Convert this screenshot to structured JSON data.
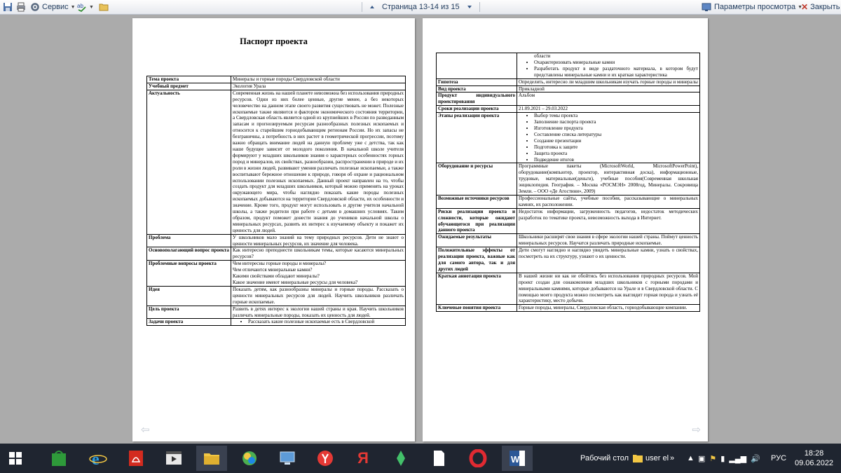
{
  "toolbar": {
    "service_label": "Сервис",
    "page_indicator": "Страница 13-14 из 15",
    "view_params_label": "Параметры просмотра",
    "close_label": "Закрыть"
  },
  "page1": {
    "title": "Паспорт проекта",
    "rows": [
      {
        "label": "Тема проекта",
        "value": "Минералы и горные породы Свердловской области"
      },
      {
        "label": "Учебный предмет",
        "value": "Экология Урала"
      },
      {
        "label": "Актуальность",
        "value": "Современная жизнь на нашей планете невозможна без использования природных ресурсов. Одни из них более ценные, другие менее, а без некоторых человечество на данном этапе своего развития существовать не может. Полезные ископаемые также являются и фактором экономического состояния территории, а Свердловская область является одной из крупнейших в России по разведанным запасам и прогнозируемым ресурсам разнообразных полезных ископаемых и относится к старейшим горнодобывающим регионам России. Но их запасы не безграничны, а потребность в них растет в геометрической прогрессии, поэтому важно обращать внимание людей на данную проблему уже с детства, так как наше будущее зависит от молодого поколения. В начальной школе учителя формируют у младших школьников знания о характерных особенностях горных пород и минералов, их свойствах, разнообразии, распространении в природе и их роли в жизни людей, развивают умения различать полезные ископаемые, а также воспитывают бережное отношение к природе, говоря об охране и рациональном использовании полезных ископаемых. Данный проект направлен на то, чтобы создать продукт для младших школьников, который можно применять на уроках окружающего мира, чтобы наглядно показать какие породы полезных ископаемых добываются на территории Свердловской области, их особенности и значение. Кроме того, продукт могут использовать и другие учителя начальной школы, а также родители при работе с детьми в домашних условиях. Таким образом, продукт поможет донести знания до учеников начальной школы о минеральных ресурсах, развить их интерес к изучаемому объекту и покажет их ценность для людей."
      },
      {
        "label": "Проблема",
        "value": "У школьников мало знаний на тему природных ресурсов. Дети не знают о ценности минеральных ресурсов, их значение для человека."
      },
      {
        "label": "Основополагающий вопрос проекта",
        "value": "Как интересно преподнести школьникам темы, которые касаются минеральных ресурсов?"
      },
      {
        "label": "Проблемные вопросы проекта",
        "value_lines": [
          "Чем интересны горные породы и минералы?",
          "Чем отличаются минеральные камни?",
          "Какими свойствами обладают минералы?",
          "Какое значение имеют минеральные ресурсы для человека?"
        ]
      },
      {
        "label": "Идея",
        "value": "Показать детям, как разнообразны минералы и горные породы. Рассказать о ценности минеральных ресурсов для людей. Научить школьников различать горные ископаемые."
      },
      {
        "label": "Цель проекта",
        "value": "Развить в детях интерес к экологии нашей страны и края. Научить школьников различать минеральные породы, показать их ценность для людей."
      },
      {
        "label": "Задачи проекта",
        "bullets": [
          "Рассказать какие полезные ископаемые есть в Свердловской"
        ]
      }
    ]
  },
  "page2": {
    "rows": [
      {
        "label": "",
        "bullets": [
          "области",
          "Охарактеризовать минеральные камни",
          "Разработать продукт в виде раздаточного материала, в котором будут представлены минеральные камни и их краткая характеристика"
        ],
        "first_plain": true
      },
      {
        "label": "Гипотеза",
        "value": "Определить, интересно ли младшим школьникам изучать горные породы и минералы"
      },
      {
        "label": "Вид проекта",
        "value": "Прикладной"
      },
      {
        "label": "Продукт индивидуального проектирования",
        "value": "Альбом"
      },
      {
        "label": "Сроки реализации проекта",
        "value": "21.09.2021 – 29.03.2022"
      },
      {
        "label": "Этапы реализации проекта",
        "bullets": [
          "Выбор темы проекта",
          "Заполнение паспорта проекта",
          "Изготовление продукта",
          "Составление списка литературы",
          "Создание презентации",
          "Подготовка к защите",
          "Защита проекта",
          "Подведение итогов"
        ]
      },
      {
        "label": "Оборудование и ресурсы",
        "value": "Программные пакеты (MicrosoftWorld, MicrosoftPowerPoint), оборудование(компьютер, проектор, интерактивная доска), информационные, трудовые, материальные(деньги), учебные пособия(Современная школьная энциклопедия. География. – Москва «РОСМЭН» 2008год, Минералы. Сокровища Земли. – ООО «Де Агостини», 2009)"
      },
      {
        "label": "Возможные источники ресурсов",
        "value": "Профессиональные сайты, учебные пособия, рассказывающие о минеральных камнях, их расположении."
      },
      {
        "label": "Риски реализации проекта и сложности, которые ожидают обучающегося при реализации данного проекта",
        "value": "Недостаток информации, загруженность педагогов, недостаток методических разработок по тематике проекта, невозможность выхода в Интернет."
      },
      {
        "label": "Ожидаемые результаты",
        "value": "Школьники расширят свои знания в сфере экологии нашей страны. Поймут ценность минеральных ресурсов. Научатся различать природные ископаемые."
      },
      {
        "label": "Положительные эффекты от реализации проекта, важные как для самого автора, так и для других людей",
        "value": "Дети смогут наглядно и наглядно увидеть минеральные камни, узнать о свойствах, посмотреть на их структуру, узнают о их ценности."
      },
      {
        "label": "Краткая аннотация проекта",
        "value": "В нашей жизни ни как не обойтись без использования природных ресурсов. Мой проект создан для ознакомления младших школьников с горными породами и минеральными камнями, которые добываются на Урале и в Свердловской области. С помощью моего продукта можно посмотреть как выглядит горная порода и узнать её характеристику, место добычи."
      },
      {
        "label": "Ключевые понятия проекта",
        "value": "Горные породы, минералы, Свердловская область, горнодобывающие компании."
      }
    ]
  },
  "taskbar": {
    "desktop_label": "Рабочий стол",
    "window_label": "user el",
    "chevron": "»",
    "lang": "РУС",
    "time": "18:28",
    "date": "09.06.2022"
  },
  "colors": {
    "accent": "#1e395b",
    "taskbar": "#1f2530",
    "background": "#ababab"
  },
  "icons": [
    "print-icon",
    "service-icon",
    "spelling-icon",
    "folder-icon",
    "prev-page-icon",
    "next-page-icon",
    "view-params-icon",
    "close-icon"
  ]
}
